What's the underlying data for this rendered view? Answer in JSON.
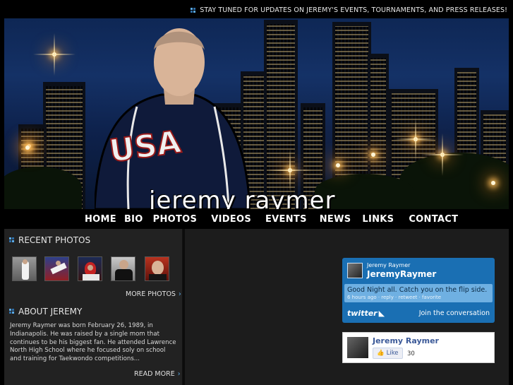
{
  "header": {
    "ticker": "STAY TUNED FOR UPDATES ON JEREMY'S EVENTS, TOURNAMENTS, AND PRESS RELEASES!"
  },
  "banner": {
    "name": "jeremy  raymer",
    "jacket_text": "USA"
  },
  "nav": {
    "items": [
      {
        "label": "HOME"
      },
      {
        "label": "BIO"
      },
      {
        "label": "PHOTOS"
      },
      {
        "label": "VIDEOS"
      },
      {
        "label": "EVENTS"
      },
      {
        "label": "NEWS"
      },
      {
        "label": "LINKS"
      },
      {
        "label": "CONTACT"
      }
    ]
  },
  "recent_photos": {
    "title": "RECENT PHOTOS",
    "more_label": "MORE PHOTOS",
    "arrow": "›"
  },
  "about": {
    "title": "ABOUT JEREMY",
    "text": "Jeremy Raymer was born February 26, 1989, in Indianapolis. He was raised by a single mom that continues to be his biggest fan. He attended Lawrence North High School where he focused soly on school and training for Taekwondo competitions...",
    "more_label": "READ MORE",
    "arrow": "›"
  },
  "twitter": {
    "display_name": "Jeremy Raymer",
    "handle": "JeremyRaymer",
    "tweet": "Good Night all. Catch you on the flip side.",
    "meta": "6 hours ago · reply · retweet · favorite",
    "logo": "twitter",
    "join": "Join the conversation"
  },
  "facebook": {
    "name": "Jeremy Raymer",
    "like_label": "Like",
    "like_count": "30"
  },
  "colors": {
    "accent": "#5aa9e6",
    "twitter_blue": "#1a6fb3",
    "facebook_blue": "#3b5998"
  }
}
